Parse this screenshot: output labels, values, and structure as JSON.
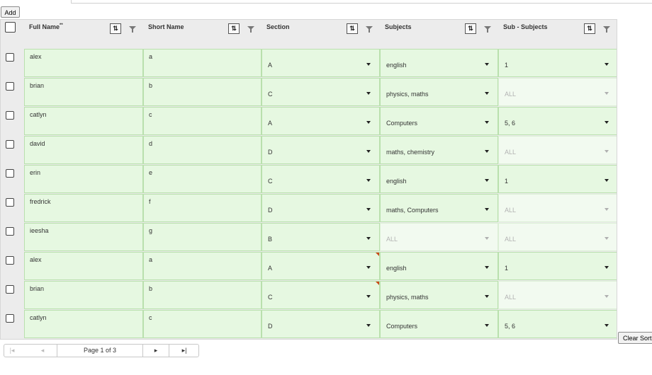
{
  "toolbar": {
    "add_label": "Add",
    "clear_sort_label": "Clear Sort"
  },
  "columns": [
    {
      "label": "Full Name",
      "required_mark": "**"
    },
    {
      "label": "Short Name",
      "required_mark": ""
    },
    {
      "label": "Section",
      "required_mark": ""
    },
    {
      "label": "Subjects",
      "required_mark": ""
    },
    {
      "label": "Sub - Subjects",
      "required_mark": ""
    }
  ],
  "sort_icon": "sort-arrows-icon",
  "filter_icon": "filter-icon",
  "rows": [
    {
      "full_name": "alex",
      "short_name": "a",
      "section": "A",
      "subjects": "english",
      "sub_subjects": "1",
      "subjects_disabled": false,
      "sub_disabled": false,
      "flag": false
    },
    {
      "full_name": "brian",
      "short_name": "b",
      "section": "C",
      "subjects": "physics, maths",
      "sub_subjects": "ALL",
      "subjects_disabled": false,
      "sub_disabled": true,
      "flag": false
    },
    {
      "full_name": "catlyn",
      "short_name": "c",
      "section": "A",
      "subjects": "Computers",
      "sub_subjects": "5, 6",
      "subjects_disabled": false,
      "sub_disabled": false,
      "flag": false
    },
    {
      "full_name": "david",
      "short_name": "d",
      "section": "D",
      "subjects": "maths, chemistry",
      "sub_subjects": "ALL",
      "subjects_disabled": false,
      "sub_disabled": true,
      "flag": false
    },
    {
      "full_name": "erin",
      "short_name": "e",
      "section": "C",
      "subjects": "english",
      "sub_subjects": "1",
      "subjects_disabled": false,
      "sub_disabled": false,
      "flag": false
    },
    {
      "full_name": "fredrick",
      "short_name": "f",
      "section": "D",
      "subjects": "maths, Computers",
      "sub_subjects": "ALL",
      "subjects_disabled": false,
      "sub_disabled": true,
      "flag": false
    },
    {
      "full_name": "ieesha",
      "short_name": "g",
      "section": "B",
      "subjects": "ALL",
      "sub_subjects": "ALL",
      "subjects_disabled": true,
      "sub_disabled": true,
      "flag": false
    },
    {
      "full_name": "alex",
      "short_name": "a",
      "section": "A",
      "subjects": "english",
      "sub_subjects": "1",
      "subjects_disabled": false,
      "sub_disabled": false,
      "flag": true
    },
    {
      "full_name": "brian",
      "short_name": "b",
      "section": "C",
      "subjects": "physics, maths",
      "sub_subjects": "ALL",
      "subjects_disabled": false,
      "sub_disabled": true,
      "flag": true
    },
    {
      "full_name": "catlyn",
      "short_name": "c",
      "section": "D",
      "subjects": "Computers",
      "sub_subjects": "5, 6",
      "subjects_disabled": false,
      "sub_disabled": false,
      "flag": false
    }
  ],
  "pager": {
    "first_icon": "first-page-icon",
    "prev_icon": "prev-page-icon",
    "page_label": "Page 1 of 3",
    "next_icon": "next-page-icon",
    "last_icon": "last-page-icon"
  },
  "colors": {
    "cell_bg": "#e6f8e1",
    "cell_border": "#b9e0ad",
    "flag": "#c94a18"
  }
}
